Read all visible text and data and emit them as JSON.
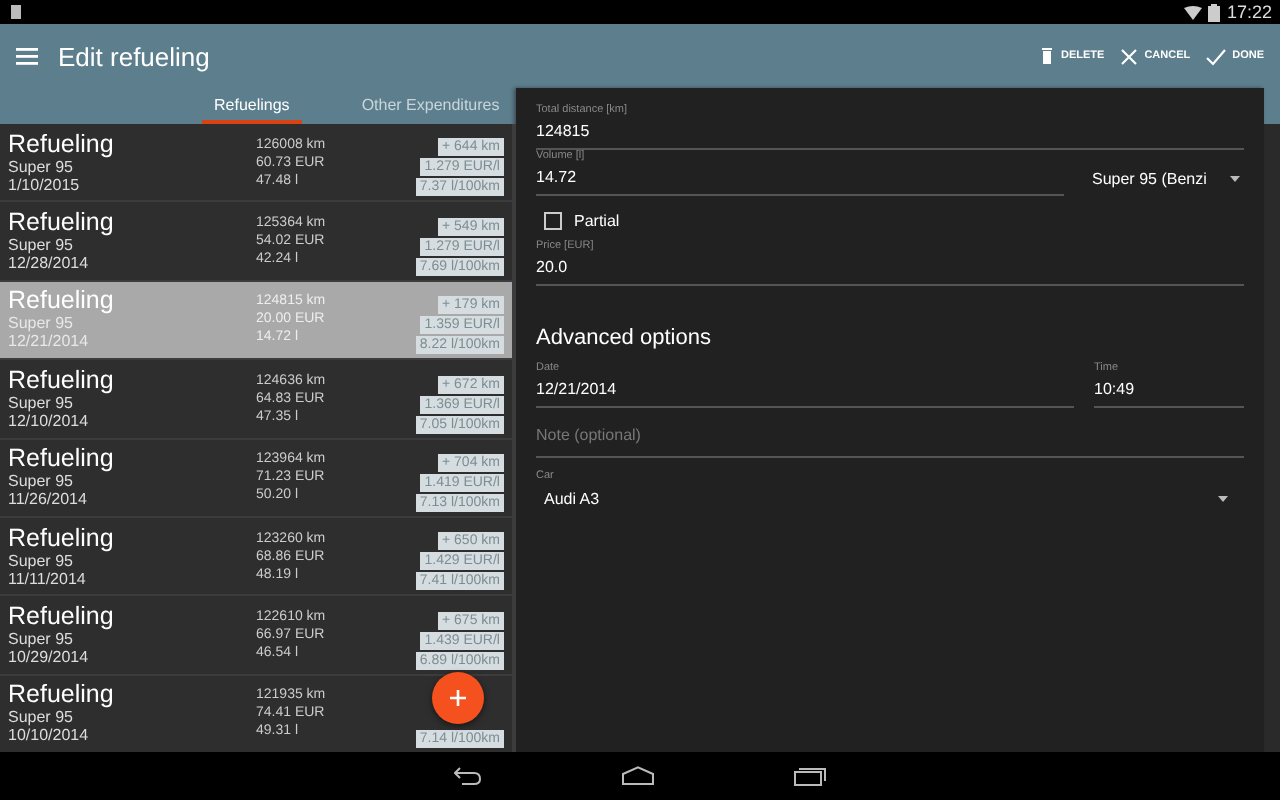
{
  "status_bar": {
    "time": "17:22"
  },
  "app_bar": {
    "title": "Edit refueling",
    "actions": [
      {
        "kind": "delete",
        "label": "DELETE"
      },
      {
        "kind": "cancel",
        "label": "CANCEL"
      },
      {
        "kind": "done",
        "label": "DONE"
      }
    ]
  },
  "tabs": [
    {
      "label": "Refuelings",
      "selected": true
    },
    {
      "label": "Other Expenditures",
      "selected": false
    }
  ],
  "refuelings": [
    {
      "title": "Refueling",
      "fuel": "Super 95",
      "date": "1/10/2015",
      "distance": "126008 km",
      "cost": "60.73 EUR",
      "volume": "47.48 l",
      "badges": [
        "+ 644 km",
        "1.279 EUR/l",
        "7.37 l/100km"
      ],
      "selected": false
    },
    {
      "title": "Refueling",
      "fuel": "Super 95",
      "date": "12/28/2014",
      "distance": "125364 km",
      "cost": "54.02 EUR",
      "volume": "42.24 l",
      "badges": [
        "+ 549 km",
        "1.279 EUR/l",
        "7.69 l/100km"
      ],
      "selected": false
    },
    {
      "title": "Refueling",
      "fuel": "Super 95",
      "date": "12/21/2014",
      "distance": "124815 km",
      "cost": "20.00 EUR",
      "volume": "14.72 l",
      "badges": [
        "+ 179 km",
        "1.359 EUR/l",
        "8.22 l/100km"
      ],
      "selected": true
    },
    {
      "title": "Refueling",
      "fuel": "Super 95",
      "date": "12/10/2014",
      "distance": "124636 km",
      "cost": "64.83 EUR",
      "volume": "47.35 l",
      "badges": [
        "+ 672 km",
        "1.369 EUR/l",
        "7.05 l/100km"
      ],
      "selected": false
    },
    {
      "title": "Refueling",
      "fuel": "Super 95",
      "date": "11/26/2014",
      "distance": "123964 km",
      "cost": "71.23 EUR",
      "volume": "50.20 l",
      "badges": [
        "+ 704 km",
        "1.419 EUR/l",
        "7.13 l/100km"
      ],
      "selected": false
    },
    {
      "title": "Refueling",
      "fuel": "Super 95",
      "date": "11/11/2014",
      "distance": "123260 km",
      "cost": "68.86 EUR",
      "volume": "48.19 l",
      "badges": [
        "+ 650 km",
        "1.429 EUR/l",
        "7.41 l/100km"
      ],
      "selected": false
    },
    {
      "title": "Refueling",
      "fuel": "Super 95",
      "date": "10/29/2014",
      "distance": "122610 km",
      "cost": "66.97 EUR",
      "volume": "46.54 l",
      "badges": [
        "+ 675 km",
        "1.439 EUR/l",
        "6.89 l/100km"
      ],
      "selected": false
    },
    {
      "title": "Refueling",
      "fuel": "Super 95",
      "date": "10/10/2014",
      "distance": "121935 km",
      "cost": "74.41 EUR",
      "volume": "49.31 l",
      "badges": [
        "7.14 l/100km"
      ],
      "selected": false
    }
  ],
  "form": {
    "distance": {
      "label": "Total distance [km]",
      "value": "124815"
    },
    "volume": {
      "label": "Volume [l]",
      "value": "14.72"
    },
    "fuel_type": {
      "value": "Super 95 (Benzi"
    },
    "partial": {
      "label": "Partial",
      "checked": false
    },
    "price": {
      "label": "Price [EUR]",
      "value": "20.0"
    },
    "advanced_heading": "Advanced options",
    "date": {
      "label": "Date",
      "value": "12/21/2014"
    },
    "time": {
      "label": "Time",
      "value": "10:49"
    },
    "note": {
      "placeholder": "Note (optional)"
    },
    "car": {
      "label": "Car",
      "value": "Audi A3"
    }
  }
}
